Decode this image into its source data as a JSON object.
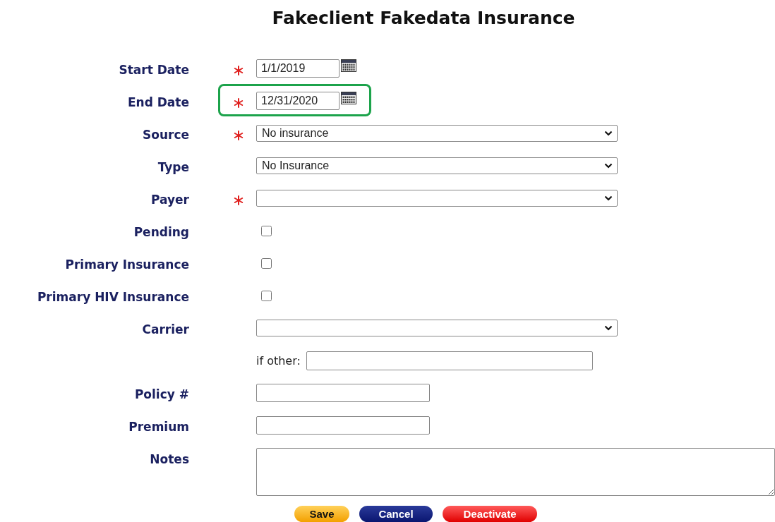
{
  "title": "Fakeclient Fakedata Insurance",
  "fields": [
    {
      "kind": "date",
      "label": "Start Date",
      "required": true,
      "value": "1/1/2019",
      "highlighted": false
    },
    {
      "kind": "date",
      "label": "End Date",
      "required": true,
      "value": "12/31/2020",
      "highlighted": true
    },
    {
      "kind": "select",
      "label": "Source",
      "required": true,
      "value": "No insurance"
    },
    {
      "kind": "select",
      "label": "Type",
      "required": false,
      "value": "No Insurance"
    },
    {
      "kind": "select",
      "label": "Payer",
      "required": true
    },
    {
      "kind": "checkbox",
      "label": "Pending",
      "checked": false
    },
    {
      "kind": "checkbox",
      "label": "Primary Insurance",
      "checked": false
    },
    {
      "kind": "checkbox",
      "label": "Primary HIV Insurance",
      "checked": false
    },
    {
      "kind": "select",
      "label": "Carrier",
      "required": false
    },
    {
      "kind": "other",
      "prompt": "if other:"
    },
    {
      "kind": "text",
      "label": "Policy #"
    },
    {
      "kind": "text",
      "label": "Premium"
    },
    {
      "kind": "textarea",
      "label": "Notes"
    }
  ],
  "buttons": [
    {
      "label": "Save",
      "kind": "save"
    },
    {
      "label": "Cancel",
      "kind": "cancel"
    },
    {
      "label": "Deactivate",
      "kind": "deactivate"
    }
  ]
}
